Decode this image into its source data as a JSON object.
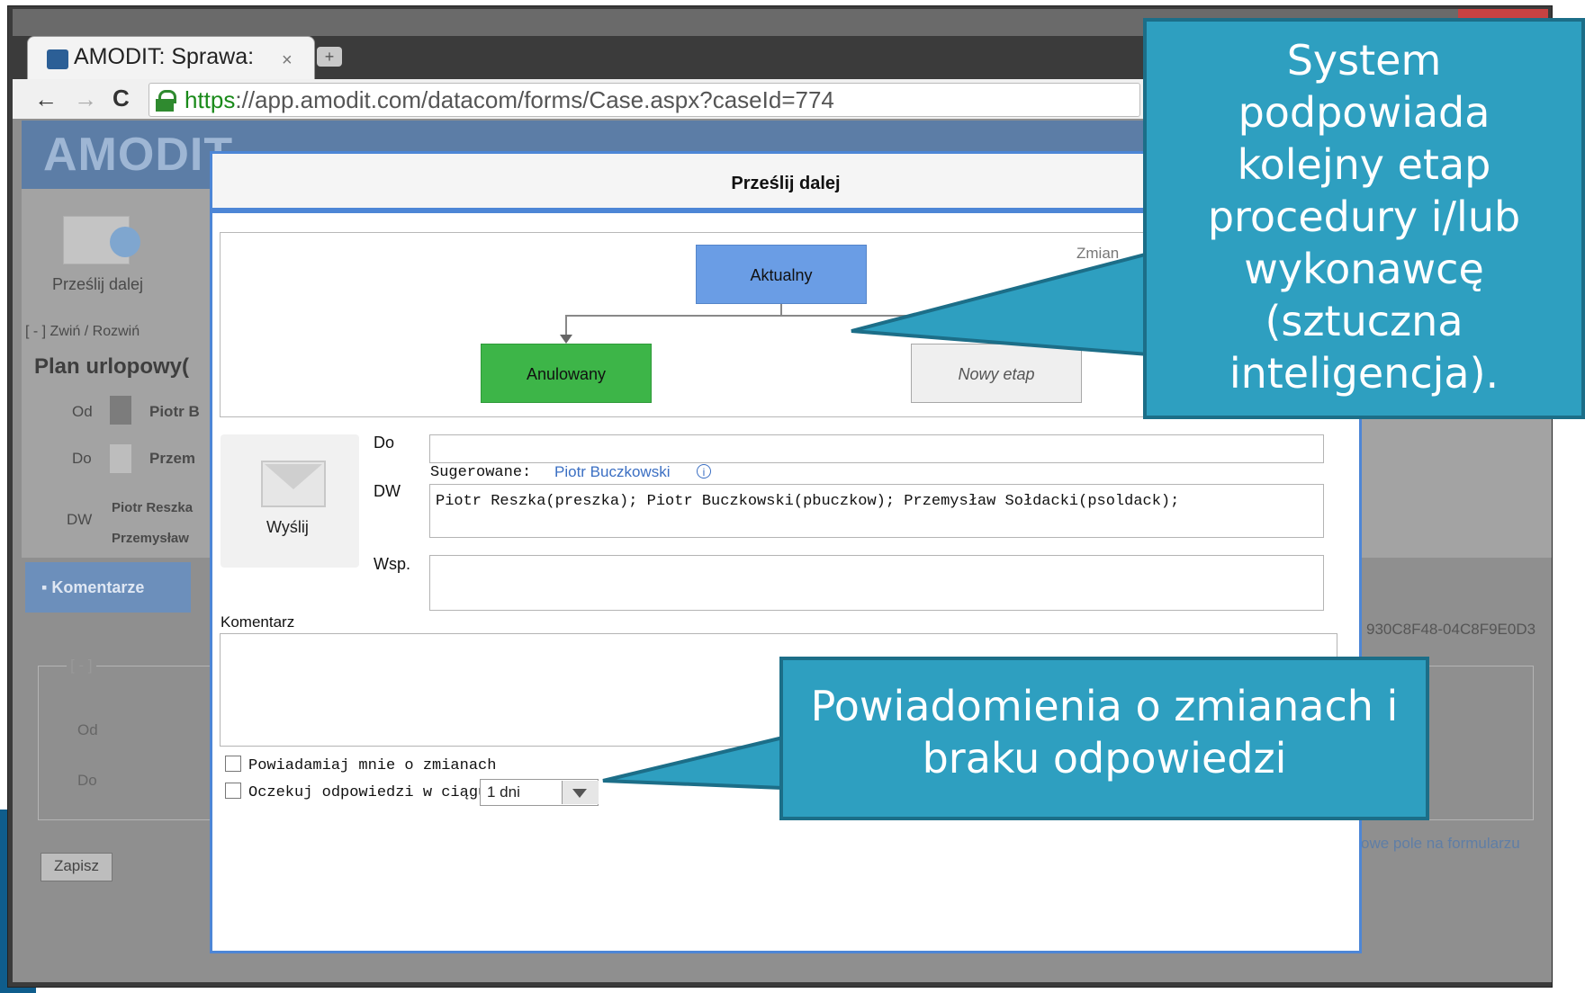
{
  "browser": {
    "tab_title": "AMODIT: Sprawa:",
    "tab_close": "×",
    "new_tab": "+",
    "url_scheme": "https",
    "url_rest": "://app.amodit.com/datacom/forms/Case.aspx?caseId=774"
  },
  "app": {
    "logo": "AMODIT",
    "toolbar_przeslij": "Prześlij dalej",
    "zwin_rozwin": "[ - ] Zwiń / Rozwiń",
    "case_title": "Plan urlopowy(",
    "od_label": "Od",
    "od_value": "Piotr B",
    "do_label": "Do",
    "do_value": "Przem",
    "dw_label": "DW",
    "dw_value1": "Piotr Reszka",
    "dw_value2": "Przemysław",
    "komentarze": "Komentarze",
    "guid_text": "930C8F48-04C8F9E0D3",
    "fieldset_legend": "[ - ]",
    "fs_od": "Od",
    "fs_do": "Do",
    "new_field_hint": "owe pole na formularzu",
    "zapisz": "Zapisz"
  },
  "dialog": {
    "title": "Prześlij dalej",
    "flow": {
      "current": "Aktualny",
      "cancelled": "Anulowany",
      "new_stage": "Nowy etap",
      "change_label": "Zmian"
    },
    "send_button": "Wyślij",
    "do_label": "Do",
    "do_value": "",
    "suggested_label": "Sugerowane:",
    "suggested_name": "Piotr Buczkowski",
    "dw_label": "DW",
    "dw_value": "Piotr Reszka(preszka); Piotr Buczkowski(pbuczkow); Przemysław Sołdacki(psoldack);",
    "wsp_label": "Wsp.",
    "wsp_value": "",
    "comment_label": "Komentarz",
    "comment_value": "",
    "notify_label": "Powiadamiaj mnie o zmianach",
    "await_label": "Oczekuj odpowiedzi w ciągu",
    "await_value": "1 dni"
  },
  "callouts": {
    "top": "System podpowiada kolejny etap procedury i/lub wykonawcę (sztuczna inteligencja).",
    "bottom": "Powiadomienia o zmianach i braku odpowiedzi"
  },
  "colors": {
    "dialog_border": "#4d86d6",
    "current_node": "#6a9de5",
    "cancelled_node": "#3db548",
    "callout_fill": "#2e9fc0"
  }
}
